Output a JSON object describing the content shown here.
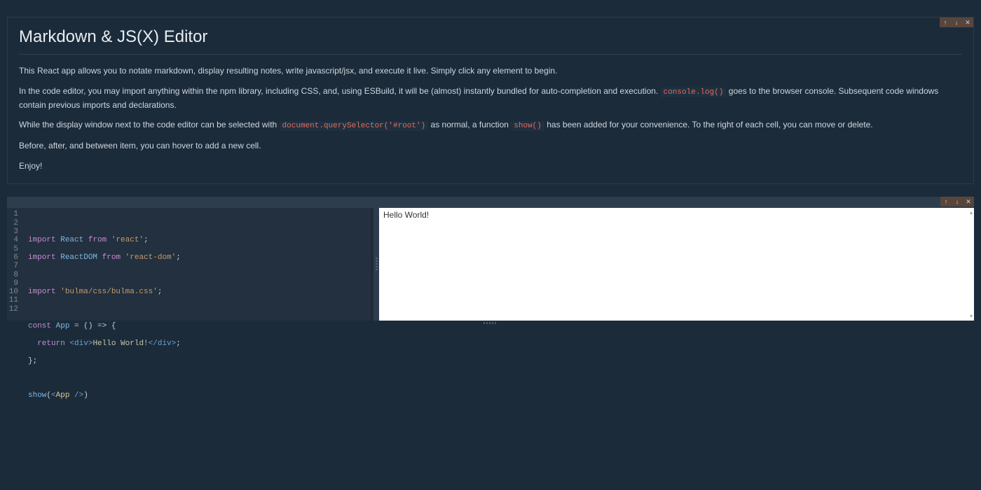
{
  "cell_actions": {
    "up_glyph": "↑",
    "down_glyph": "↓",
    "close_glyph": "✕"
  },
  "markdown_cell": {
    "title": "Markdown & JS(X) Editor",
    "p1": "This React app allows you to notate markdown, display resulting notes, write javascript/jsx, and execute it live. Simply click any element to begin.",
    "p2_a": "In the code editor, you may import anything within the npm library, including CSS, and, using ESBuild, it will be (almost) instantly bundled for auto-completion and execution. ",
    "p2_code": "console.log()",
    "p2_b": " goes to the browser console. Subsequent code windows contain previous imports and declarations.",
    "p3_a": "While the display window next to the code editor can be selected with ",
    "p3_code1": "document.querySelector('#root')",
    "p3_b": " as normal, a function ",
    "p3_code2": "show()",
    "p3_c": " has been added for your convenience. To the right of each cell, you can move or delete.",
    "p4": "Before, after, and between item, you can hover to add a new cell.",
    "p5": "Enjoy!"
  },
  "code_cell": {
    "line_numbers": [
      "1",
      "2",
      "3",
      "4",
      "5",
      "6",
      "7",
      "8",
      "9",
      "10",
      "11",
      "12"
    ],
    "tokens": {
      "import": "import",
      "React": "React",
      "from": "from",
      "react_str": "'react'",
      "semi": ";",
      "ReactDOM": "ReactDOM",
      "reactdom_str": "'react-dom'",
      "bulma_str": "'bulma/css/bulma.css'",
      "const": "const",
      "App": "App",
      "eq": " = ",
      "arrow": "() => {",
      "return": "return",
      "div_open": "<div>",
      "hello": "Hello World!",
      "div_close": "</div>",
      "closebrace": "};",
      "show": "show",
      "paren_open": "(",
      "app_open": "<",
      "app_name": "App",
      "app_close": " />",
      "paren_close": ")"
    },
    "preview_output": "Hello World!"
  }
}
